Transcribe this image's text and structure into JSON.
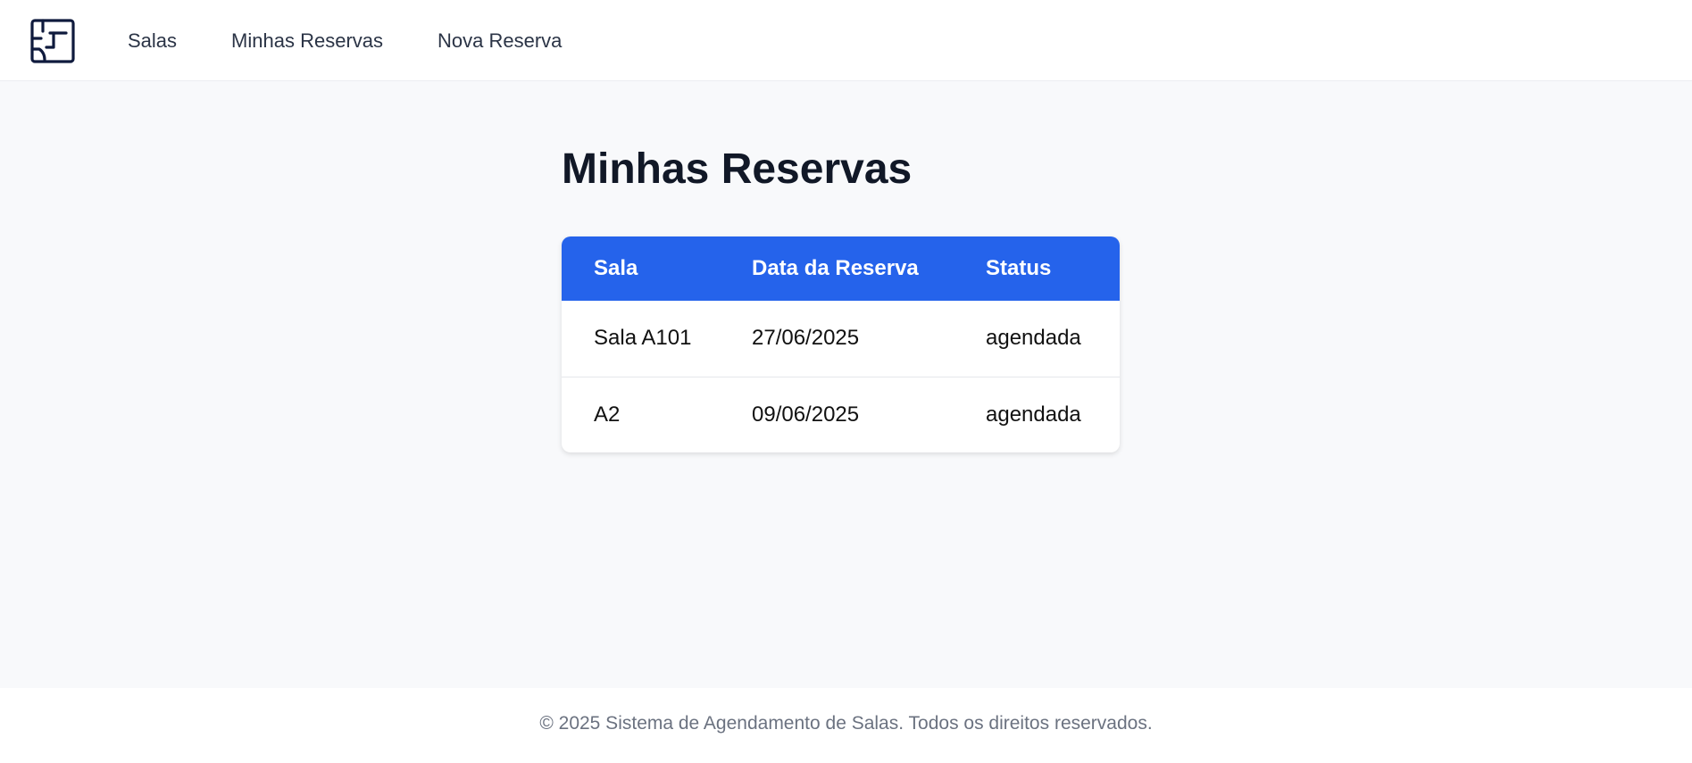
{
  "header": {
    "logo_icon": "floor-plan-icon",
    "nav": [
      {
        "label": "Salas"
      },
      {
        "label": "Minhas Reservas"
      },
      {
        "label": "Nova Reserva"
      }
    ]
  },
  "main": {
    "title": "Minhas Reservas",
    "table": {
      "columns": [
        "Sala",
        "Data da Reserva",
        "Status"
      ],
      "rows": [
        {
          "sala": "Sala A101",
          "data": "27/06/2025",
          "status": "agendada"
        },
        {
          "sala": "A2",
          "data": "09/06/2025",
          "status": "agendada"
        }
      ]
    }
  },
  "footer": {
    "text": "© 2025 Sistema de Agendamento de Salas. Todos os direitos reservados."
  },
  "colors": {
    "accent": "#2563eb",
    "background": "#f8f9fb",
    "logo": "#0f1a3d"
  }
}
